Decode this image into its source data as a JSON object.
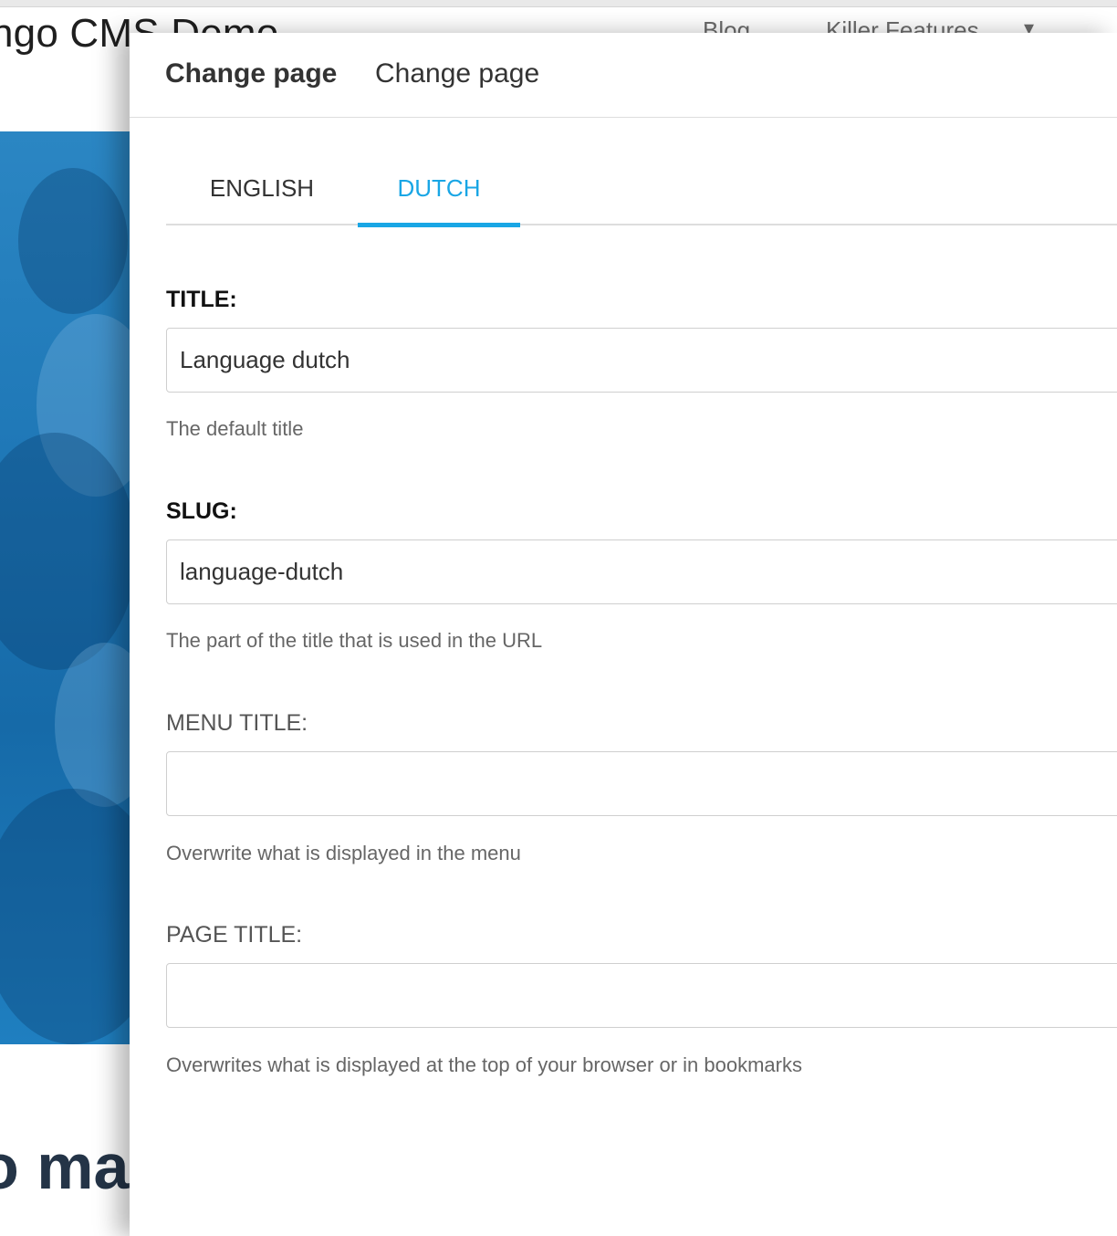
{
  "background_site": {
    "site_title": "ngo CMS Demo",
    "nav_blog": "Blog",
    "nav_killer_features": "Killer Features",
    "nav_caret": "▾",
    "hero_heading": "o ma"
  },
  "modal": {
    "title": "Change page",
    "breadcrumb": "Change page",
    "tabs": [
      {
        "label": "ENGLISH",
        "active": false
      },
      {
        "label": "DUTCH",
        "active": true
      }
    ],
    "fields": {
      "title": {
        "label": "TITLE:",
        "value": "Language dutch",
        "help": "The default title"
      },
      "slug": {
        "label": "SLUG:",
        "value": "language-dutch",
        "help": "The part of the title that is used in the URL"
      },
      "menu_title": {
        "label": "MENU TITLE:",
        "value": "",
        "help": "Overwrite what is displayed in the menu"
      },
      "page_title": {
        "label": "PAGE TITLE:",
        "value": "",
        "help": "Overwrites what is displayed at the top of your browser or in bookmarks"
      }
    }
  },
  "colors": {
    "active_tab": "#19a6e5",
    "hero_blue": "#1f78b7",
    "text_dark": "#333333"
  }
}
